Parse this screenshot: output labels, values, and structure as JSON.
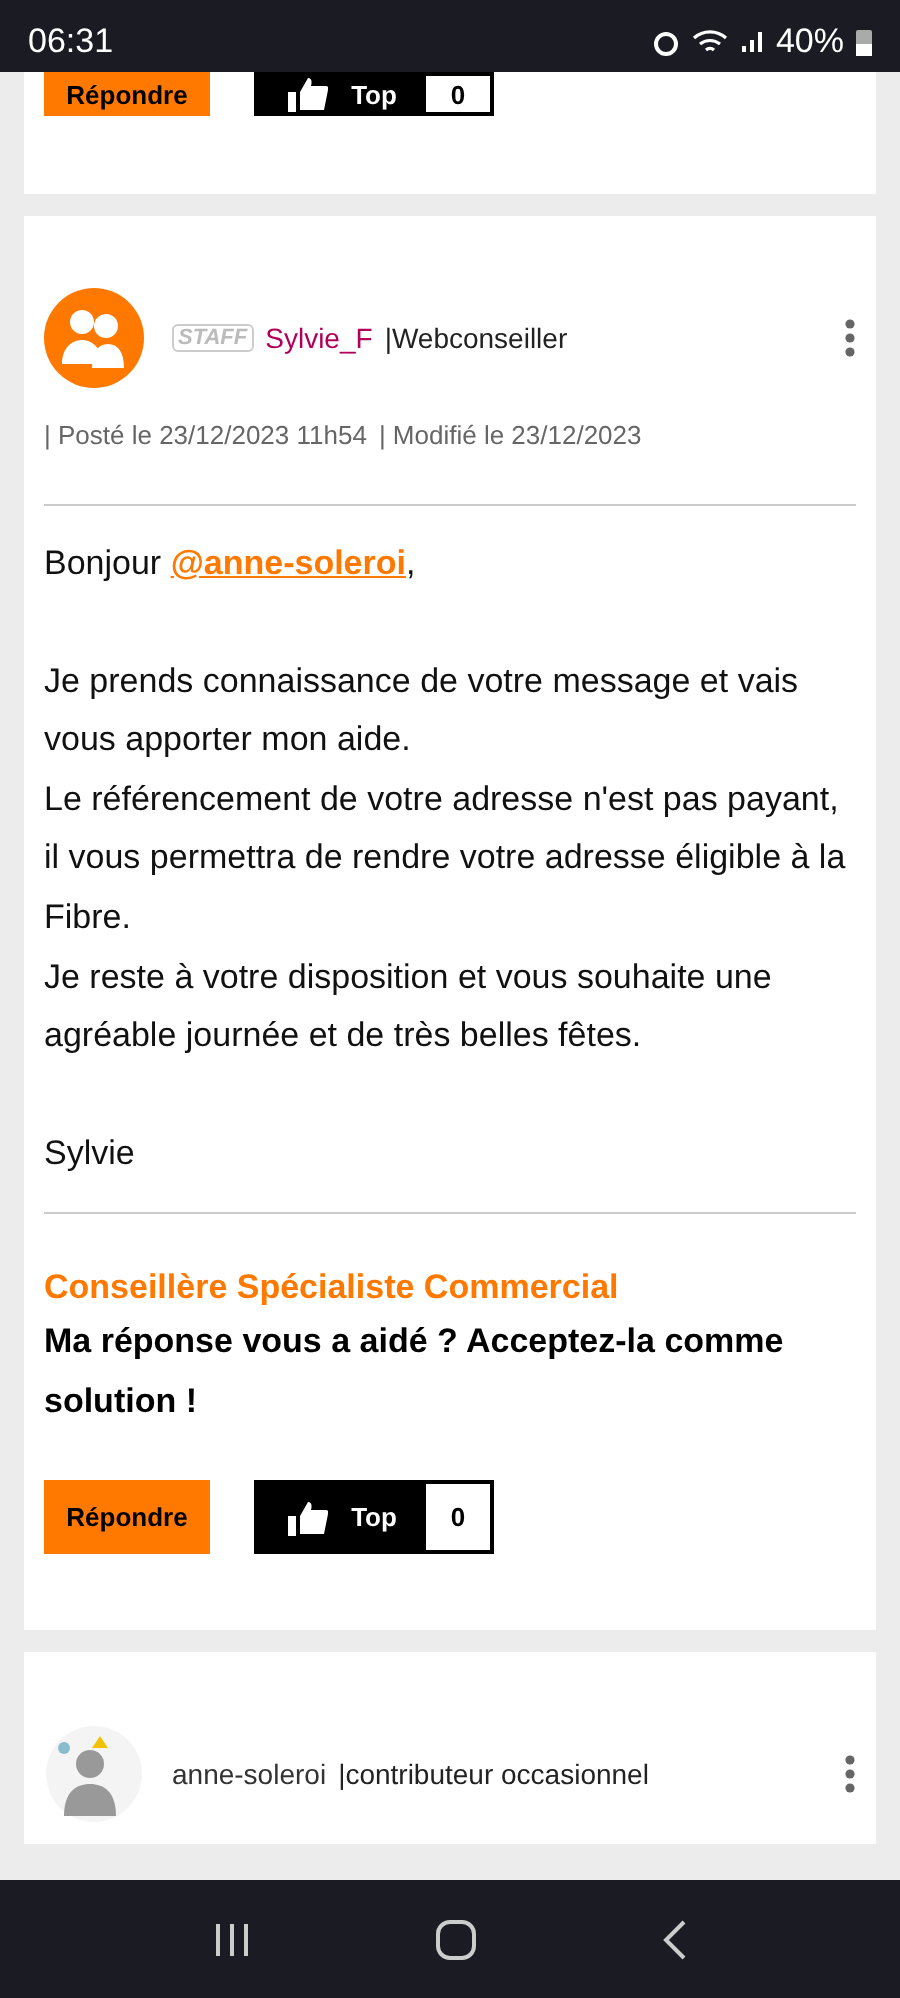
{
  "status_bar": {
    "time": "06:31",
    "battery": "40%"
  },
  "previous_post": {
    "reply_button": "Répondre",
    "top_button": "Top",
    "top_count": "0"
  },
  "post": {
    "badge": "STAFF",
    "author": "Sylvie_F",
    "role": "|Webconseiller",
    "posted": "| Posté le 23/12/2023 11h54",
    "modified": "| Modifié le 23/12/2023",
    "body": [
      {
        "parts": [
          "Bonjour ",
          "@anne-soleroi",
          ","
        ]
      },
      {
        "text": "Je prends connaissance de votre message et vais vous apporter mon aide.\nLe référencement de votre adresse n'est pas payant, il vous permettra de rendre votre adresse éligible à la Fibre.\nJe reste à votre disposition et vous souhaite une agréable journée et de très belles fêtes."
      },
      {
        "text": "Sylvie"
      }
    ],
    "signature_title": "Conseillère Spécialiste Commercial",
    "signature_text": "Ma réponse vous a aidé ? Acceptez-la comme solution !",
    "reply_button": "Répondre",
    "top_button": "Top",
    "top_count": "0"
  },
  "next_post": {
    "author": "anne-soleroi",
    "role": "|contributeur occasionnel"
  }
}
